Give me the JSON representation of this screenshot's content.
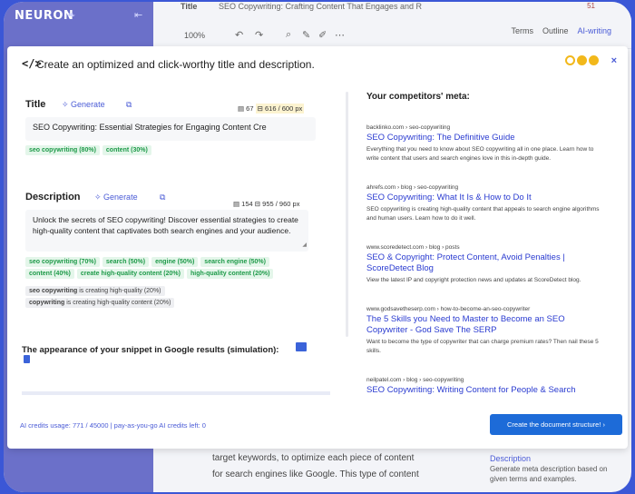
{
  "app": {
    "logo": "NEURON",
    "doc_label": "Title",
    "doc_title": "SEO Copywriting: Crafting Content That Engages and R",
    "top_badge": "51",
    "zoom": "100%",
    "tabs": [
      "Terms",
      "Outline",
      "AI-writing"
    ]
  },
  "background": {
    "line1": "target keywords, to optimize each piece of content",
    "line2": "for search engines like Google. This type of content",
    "right_heading": "Description",
    "right_text": "Generate meta description based on given terms and examples."
  },
  "modal": {
    "icon": "</>",
    "title": "Create an optimized and click-worthy title and description.",
    "close": "×"
  },
  "title_section": {
    "label": "Title",
    "generate": "Generate",
    "chars": "67",
    "px": "616 / 600 px",
    "value": "SEO Copywriting: Essential Strategies for Engaging Content Cre",
    "chips": [
      "seo copywriting (80%)",
      "content (30%)"
    ]
  },
  "desc_section": {
    "label": "Description",
    "generate": "Generate",
    "chars": "154",
    "px": "955 / 960 px",
    "value": "Unlock the secrets of SEO copywriting! Discover essential strategies to create high-quality content that captivates both search engines and your audience.",
    "chips": [
      "seo copywriting (70%)",
      "search (50%)",
      "engine (50%)",
      "search engine (50%)",
      "content (40%)",
      "create high-quality content (20%)",
      "high-quality content (20%)"
    ],
    "grey_chips": [
      {
        "bold": "seo copywriting",
        "rest": " is creating high-quality (20%)"
      },
      {
        "bold": "copywriting",
        "rest": " is creating high-quality content (20%)"
      }
    ]
  },
  "simulation": {
    "label": "The appearance of your snippet in Google results (simulation):"
  },
  "competitors": {
    "heading": "Your competitors' meta:",
    "items": [
      {
        "url": "backlinko.com › seo-copywriting",
        "title": "SEO Copywriting: The Definitive Guide",
        "snippet": "Everything that you need to know about SEO copywriting all in one place. Learn how to write content that users and search engines love in this in-depth guide."
      },
      {
        "url": "ahrefs.com › blog › seo-copywriting",
        "title": "SEO Copywriting: What It Is & How to Do It",
        "snippet": "SEO copywriting is creating high-quality content that appeals to search engine algorithms and human users. Learn how to do it well."
      },
      {
        "url": "www.scoredetect.com › blog › posts",
        "title": "SEO & Copyright: Protect Content, Avoid Penalties | ScoreDetect Blog",
        "snippet": "View the latest IP and copyright protection news and updates at ScoreDetect blog."
      },
      {
        "url": "www.godsavetheserp.com › how-to-become-an-seo-copywriter",
        "title": "The 5 Skills you Need to Master to Become an SEO Copywriter - God Save The SERP",
        "snippet": "Want to become the type of copywriter that can charge premium rates? Then nail these 5 skills."
      },
      {
        "url": "neilpatel.com › blog › seo-copywriting",
        "title": "SEO Copywriting: Writing Content for People & Search",
        "snippet": ""
      }
    ]
  },
  "footer": {
    "credits": "AI credits usage: 771 / 45000 | pay-as-you-go AI credits left: 0",
    "button": "Create the document structure! ›"
  },
  "colors": {
    "accent": "#4a5bd6",
    "button": "#1d6bd8",
    "chip_green": "#1e9a49",
    "frame": "#3b57d6"
  }
}
